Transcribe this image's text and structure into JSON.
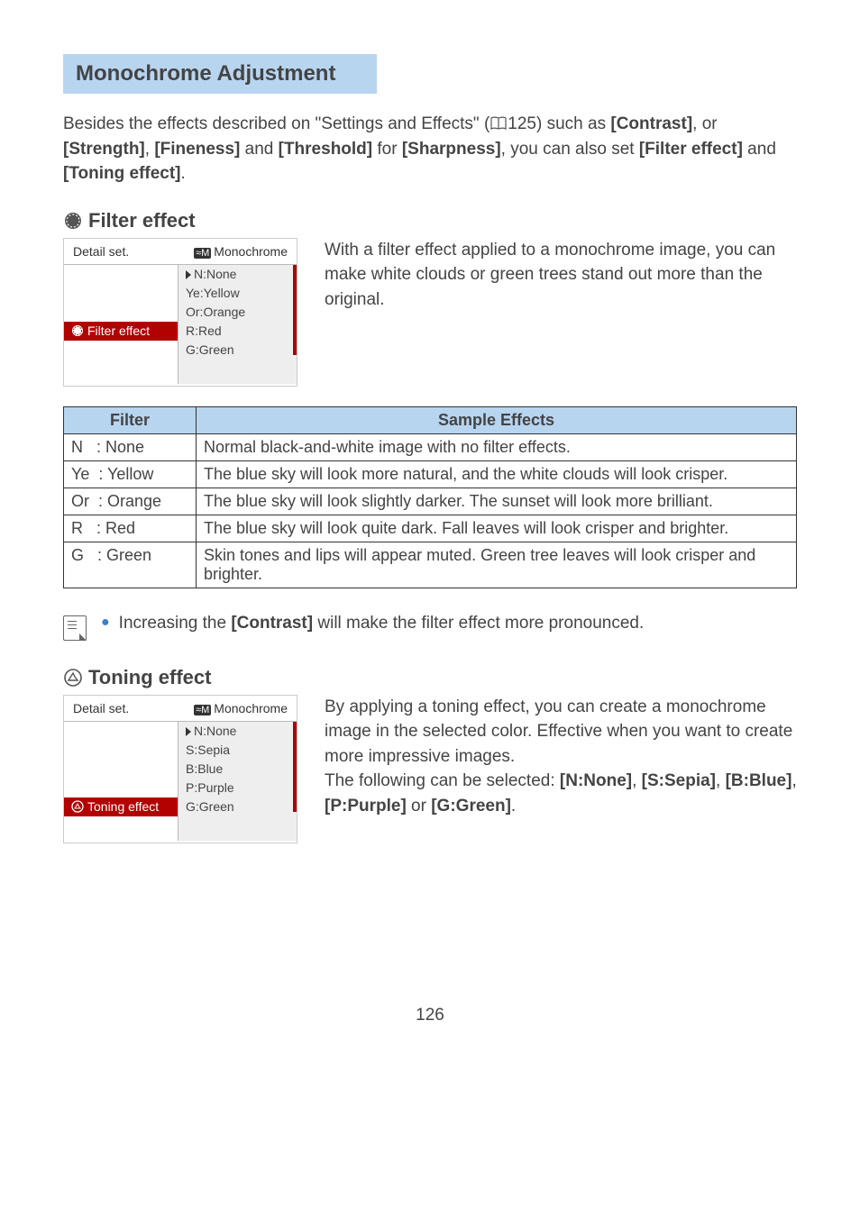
{
  "section_title": "Monochrome Adjustment",
  "intro_parts": {
    "p1": "Besides the effects described on \"Settings and Effects\" (",
    "ref": "125",
    "p2": ") such as ",
    "b1": "[Contrast]",
    "p3": ", or ",
    "b2": "[Strength]",
    "p4": ", ",
    "b3": "[Fineness]",
    "p5": " and ",
    "b4": "[Threshold]",
    "p6": " for ",
    "b5": "[Sharpness]",
    "p7": ", you can also set ",
    "b6": "[Filter effect]",
    "p8": " and ",
    "b7": "[Toning effect]",
    "p9": "."
  },
  "filter": {
    "title": "Filter effect",
    "desc": "With a filter effect applied to a monochrome image, you can make white clouds or green trees stand out more than the original.",
    "lcd": {
      "header_left": "Detail set.",
      "header_right": "Monochrome",
      "selected_label": "Filter effect",
      "options": [
        "N:None",
        "Ye:Yellow",
        "Or:Orange",
        "R:Red",
        "G:Green"
      ]
    }
  },
  "table": {
    "headers": [
      "Filter",
      "Sample Effects"
    ],
    "rows": [
      {
        "code": "N",
        "name": ": None",
        "effect": "Normal black-and-white image with no filter effects."
      },
      {
        "code": "Ye",
        "name": ": Yellow",
        "effect": "The blue sky will look more natural, and the white clouds will look crisper."
      },
      {
        "code": "Or",
        "name": ": Orange",
        "effect": "The blue sky will look slightly darker. The sunset will look more brilliant."
      },
      {
        "code": "R",
        "name": ": Red",
        "effect": "The blue sky will look quite dark. Fall leaves will look crisper and brighter."
      },
      {
        "code": "G",
        "name": ": Green",
        "effect": "Skin tones and lips will appear muted. Green tree leaves will look crisper and brighter."
      }
    ]
  },
  "note": {
    "pre": "Increasing the ",
    "bold": "[Contrast]",
    "post": " will make the filter effect more pronounced."
  },
  "toning": {
    "title": "Toning effect",
    "desc_p1": "By applying a toning effect, you can create a monochrome image in the selected color. Effective when you want to create more impressive images.",
    "desc_p2_pre": "The following can be selected: ",
    "options_bold": [
      "[N:None]",
      "[S:Sepia]",
      "[B:Blue]",
      "[P:Purple]",
      "[G:Green]"
    ],
    "separators": [
      ", ",
      ", ",
      ", ",
      " or ",
      "."
    ],
    "lcd": {
      "header_left": "Detail set.",
      "header_right": "Monochrome",
      "selected_label": "Toning effect",
      "options": [
        "N:None",
        "S:Sepia",
        "B:Blue",
        "P:Purple",
        "G:Green"
      ]
    }
  },
  "page_number": "126"
}
